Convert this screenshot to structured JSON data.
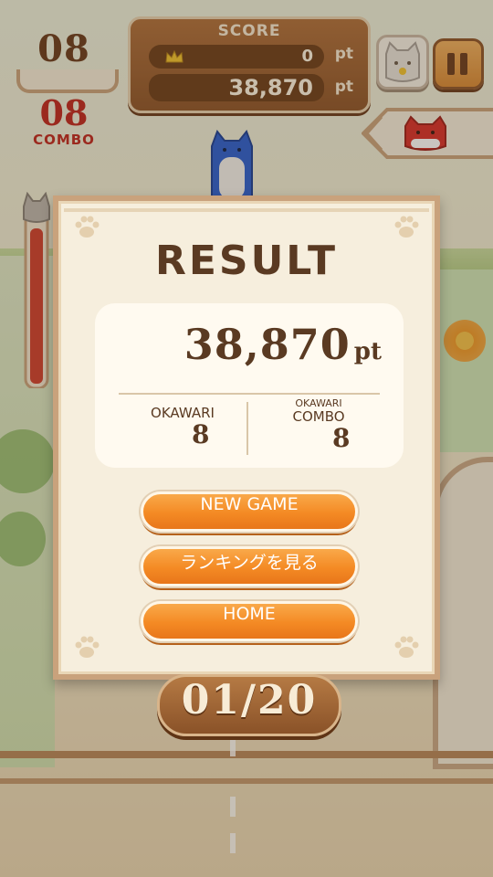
{
  "hud": {
    "okawari_count": "08",
    "combo_count": "08",
    "combo_label": "COMBO",
    "score": {
      "title": "SCORE",
      "rank": "1",
      "best_value": "0",
      "current_value": "38,870",
      "unit": "pt"
    },
    "round": "01/20"
  },
  "result": {
    "title": "RESULT",
    "score": "38,870",
    "unit": "pt",
    "okawari_label": "OKAWARI",
    "okawari_value": "8",
    "combo_small_label": "OKAWARI",
    "combo_label": "COMBO",
    "combo_value": "8",
    "buttons": {
      "new_game": "NEW GAME",
      "ranking": "ランキングを見る",
      "home": "HOME"
    }
  },
  "colors": {
    "brown_text": "#5a3a22",
    "combo_red": "#c0271f",
    "button_orange": "#f48a24",
    "panel_brown": "#8e552a"
  },
  "icons": [
    "crown-icon",
    "cat-face-icon",
    "pause-icon",
    "red-cat-icon",
    "blue-cat-icon",
    "paw-icon",
    "thermometer-icon"
  ]
}
